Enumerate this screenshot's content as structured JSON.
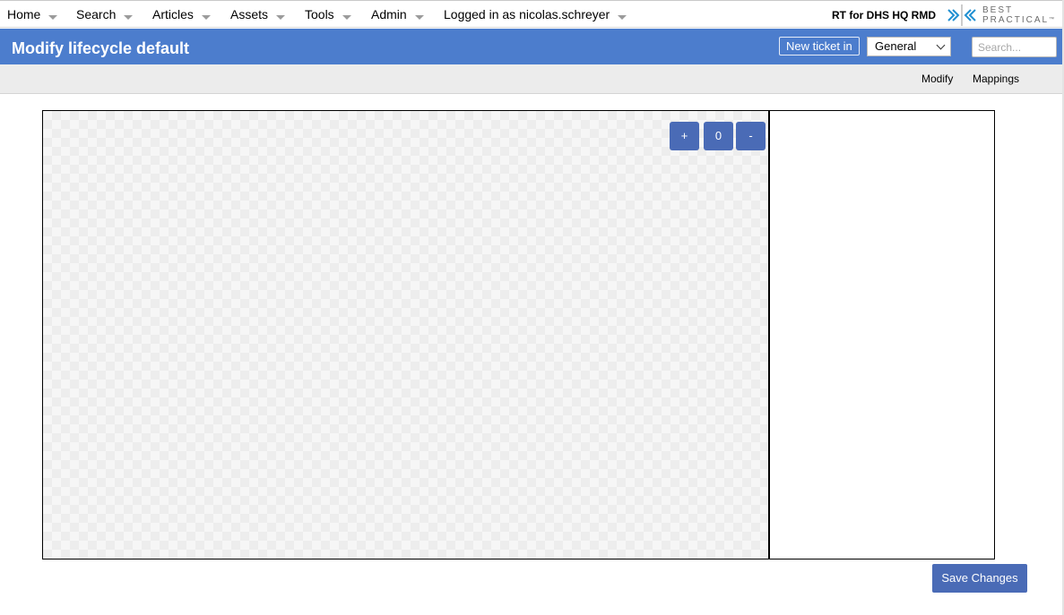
{
  "menu": {
    "items": [
      {
        "label": "Home"
      },
      {
        "label": "Search"
      },
      {
        "label": "Articles"
      },
      {
        "label": "Assets"
      },
      {
        "label": "Tools"
      },
      {
        "label": "Admin"
      },
      {
        "label": "Logged in as nicolas.schreyer"
      }
    ]
  },
  "brand": {
    "rt_name": "RT for DHS HQ RMD",
    "logo_line1": "BEST",
    "logo_line2": "PRACTICAL",
    "logo_tm": "™",
    "logo_icon": "chevrons-logo-icon",
    "logo_color": "#1f8fd1"
  },
  "header": {
    "title": "Modify lifecycle default",
    "new_ticket_label": "New ticket in",
    "queue_selected": "General",
    "search_placeholder": "Search...",
    "background_color": "#4c7dcd"
  },
  "subnav": {
    "links": [
      {
        "label": "Modify"
      },
      {
        "label": "Mappings"
      }
    ]
  },
  "editor": {
    "zoom_in_label": "+",
    "zoom_reset_label": "0",
    "zoom_out_label": "-",
    "button_color": "#4a6bb6"
  },
  "footer": {
    "save_label": "Save Changes"
  }
}
